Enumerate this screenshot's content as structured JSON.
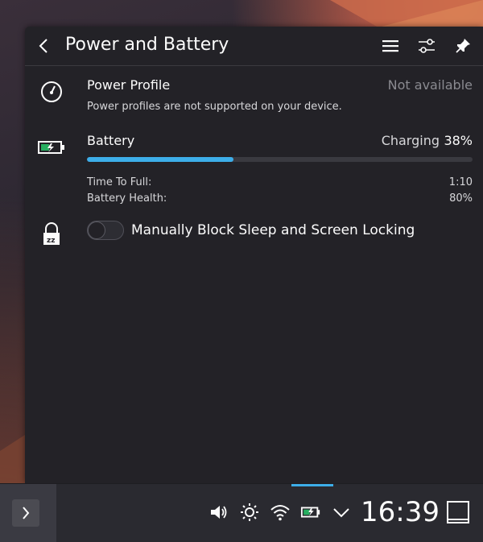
{
  "header": {
    "title": "Power and Battery"
  },
  "power_profile": {
    "label": "Power Profile",
    "status": "Not available",
    "description": "Power profiles are not supported on your device."
  },
  "battery": {
    "label": "Battery",
    "state": "Charging",
    "percent_text": "38%",
    "percent_value": 38,
    "time_to_full_label": "Time To Full:",
    "time_to_full_value": "1:10",
    "health_label": "Battery Health:",
    "health_value": "80%"
  },
  "inhibit": {
    "label": "Manually Block Sleep and Screen Locking",
    "enabled": false
  },
  "taskbar": {
    "clock": "16:39"
  },
  "colors": {
    "accent": "#3daee9",
    "battery_charge": "#27ae60",
    "popup_bg": "#232227"
  },
  "icons": [
    "back-arrow-icon",
    "menu-icon",
    "configure-icon",
    "pin-icon",
    "speedometer-icon",
    "battery-charging-icon",
    "sleep-lock-icon",
    "chevron-right-icon",
    "volume-icon",
    "brightness-icon",
    "wifi-icon",
    "battery-tray-icon",
    "chevron-down-icon",
    "show-desktop-icon"
  ]
}
